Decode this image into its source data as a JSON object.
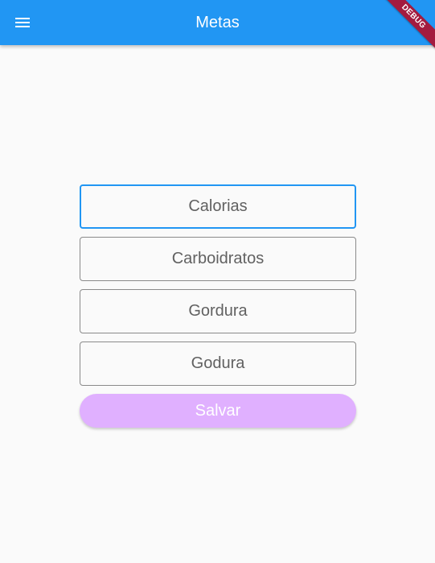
{
  "appbar": {
    "title": "Metas",
    "menu_icon": "menu-icon",
    "background_color": "#2196f3"
  },
  "debug_banner": {
    "label": "DEBUG",
    "color": "#a31b3f"
  },
  "form": {
    "fields": [
      {
        "placeholder": "Calorias",
        "value": "",
        "focused": true
      },
      {
        "placeholder": "Carboidratos",
        "value": ""
      },
      {
        "placeholder": "Gordura",
        "value": ""
      },
      {
        "placeholder": "Godura",
        "value": ""
      }
    ],
    "focus_color": "#2196f3",
    "save_label": "Salvar",
    "save_color": "#e0b0ff"
  }
}
